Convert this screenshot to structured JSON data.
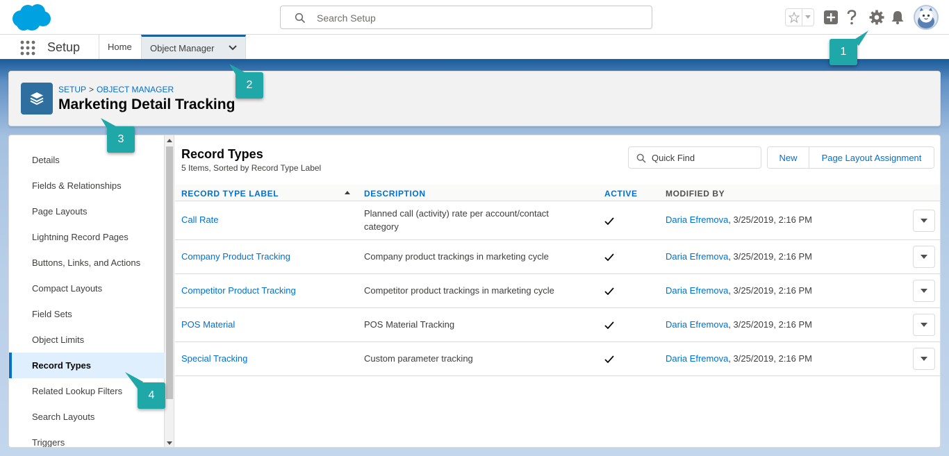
{
  "header": {
    "search_placeholder": "Search Setup"
  },
  "context": {
    "app_name": "Setup",
    "tabs": [
      {
        "label": "Home"
      },
      {
        "label": "Object Manager"
      }
    ]
  },
  "page_header": {
    "breadcrumb": [
      "SETUP",
      "OBJECT MANAGER"
    ],
    "breadcrumb_sep": ">",
    "title": "Marketing Detail Tracking"
  },
  "sidebar": {
    "items": [
      {
        "label": "Details"
      },
      {
        "label": "Fields & Relationships"
      },
      {
        "label": "Page Layouts"
      },
      {
        "label": "Lightning Record Pages"
      },
      {
        "label": "Buttons, Links, and Actions"
      },
      {
        "label": "Compact Layouts"
      },
      {
        "label": "Field Sets"
      },
      {
        "label": "Object Limits"
      },
      {
        "label": "Record Types",
        "active": true
      },
      {
        "label": "Related Lookup Filters"
      },
      {
        "label": "Search Layouts"
      },
      {
        "label": "Triggers"
      }
    ]
  },
  "main": {
    "title": "Record Types",
    "subtitle": "5 Items, Sorted by Record Type Label",
    "quick_find_placeholder": "Quick Find",
    "buttons": {
      "new": "New",
      "page_layout_assignment": "Page Layout Assignment"
    },
    "columns": {
      "label": "RECORD TYPE LABEL",
      "description": "DESCRIPTION",
      "active": "ACTIVE",
      "modified_by": "MODIFIED BY"
    },
    "rows": [
      {
        "label": "Call Rate",
        "description": "Planned call (activity) rate per account/contact category",
        "active": true,
        "user": "Daria Efremova",
        "date": ", 3/25/2019, 2:16 PM"
      },
      {
        "label": "Company Product Tracking",
        "description": "Company product trackings in marketing cycle",
        "active": true,
        "user": "Daria Efremova",
        "date": ", 3/25/2019, 2:16 PM"
      },
      {
        "label": "Competitor Product Tracking",
        "description": "Competitor product trackings in marketing cycle",
        "active": true,
        "user": "Daria Efremova",
        "date": ", 3/25/2019, 2:16 PM"
      },
      {
        "label": "POS Material",
        "description": "POS Material Tracking",
        "active": true,
        "user": "Daria Efremova",
        "date": ", 3/25/2019, 2:16 PM"
      },
      {
        "label": "Special Tracking",
        "description": "Custom parameter tracking",
        "active": true,
        "user": "Daria Efremova",
        "date": ", 3/25/2019, 2:16 PM"
      }
    ]
  },
  "callouts": [
    "1",
    "2",
    "3",
    "4"
  ],
  "colors": {
    "brand": "#0070d2",
    "callout": "#20a7a8",
    "band": "#1f5f9d"
  }
}
